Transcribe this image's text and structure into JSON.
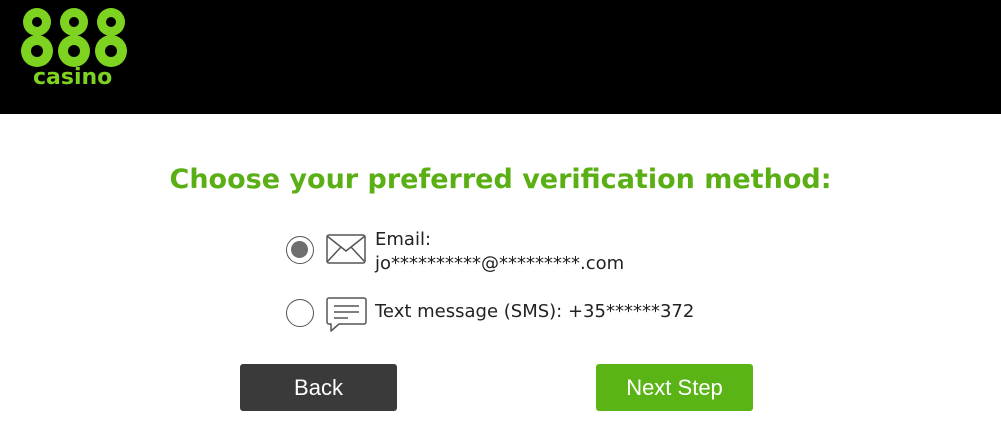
{
  "brand": {
    "logo_digits": "888",
    "logo_word": "casino",
    "color": "#7ed321"
  },
  "page": {
    "title": "Choose your preferred verification method:",
    "title_color": "#5aaf14"
  },
  "options": [
    {
      "icon": "envelope-icon",
      "line1": "Email:",
      "line2": "jo**********@*********.com",
      "selected": true
    },
    {
      "icon": "chat-bubble-icon",
      "label": "Text message (SMS): +35******372",
      "selected": false
    }
  ],
  "buttons": {
    "back_label": "Back",
    "next_label": "Next Step",
    "back_color": "#3a3a3a",
    "next_color": "#5ab416"
  }
}
